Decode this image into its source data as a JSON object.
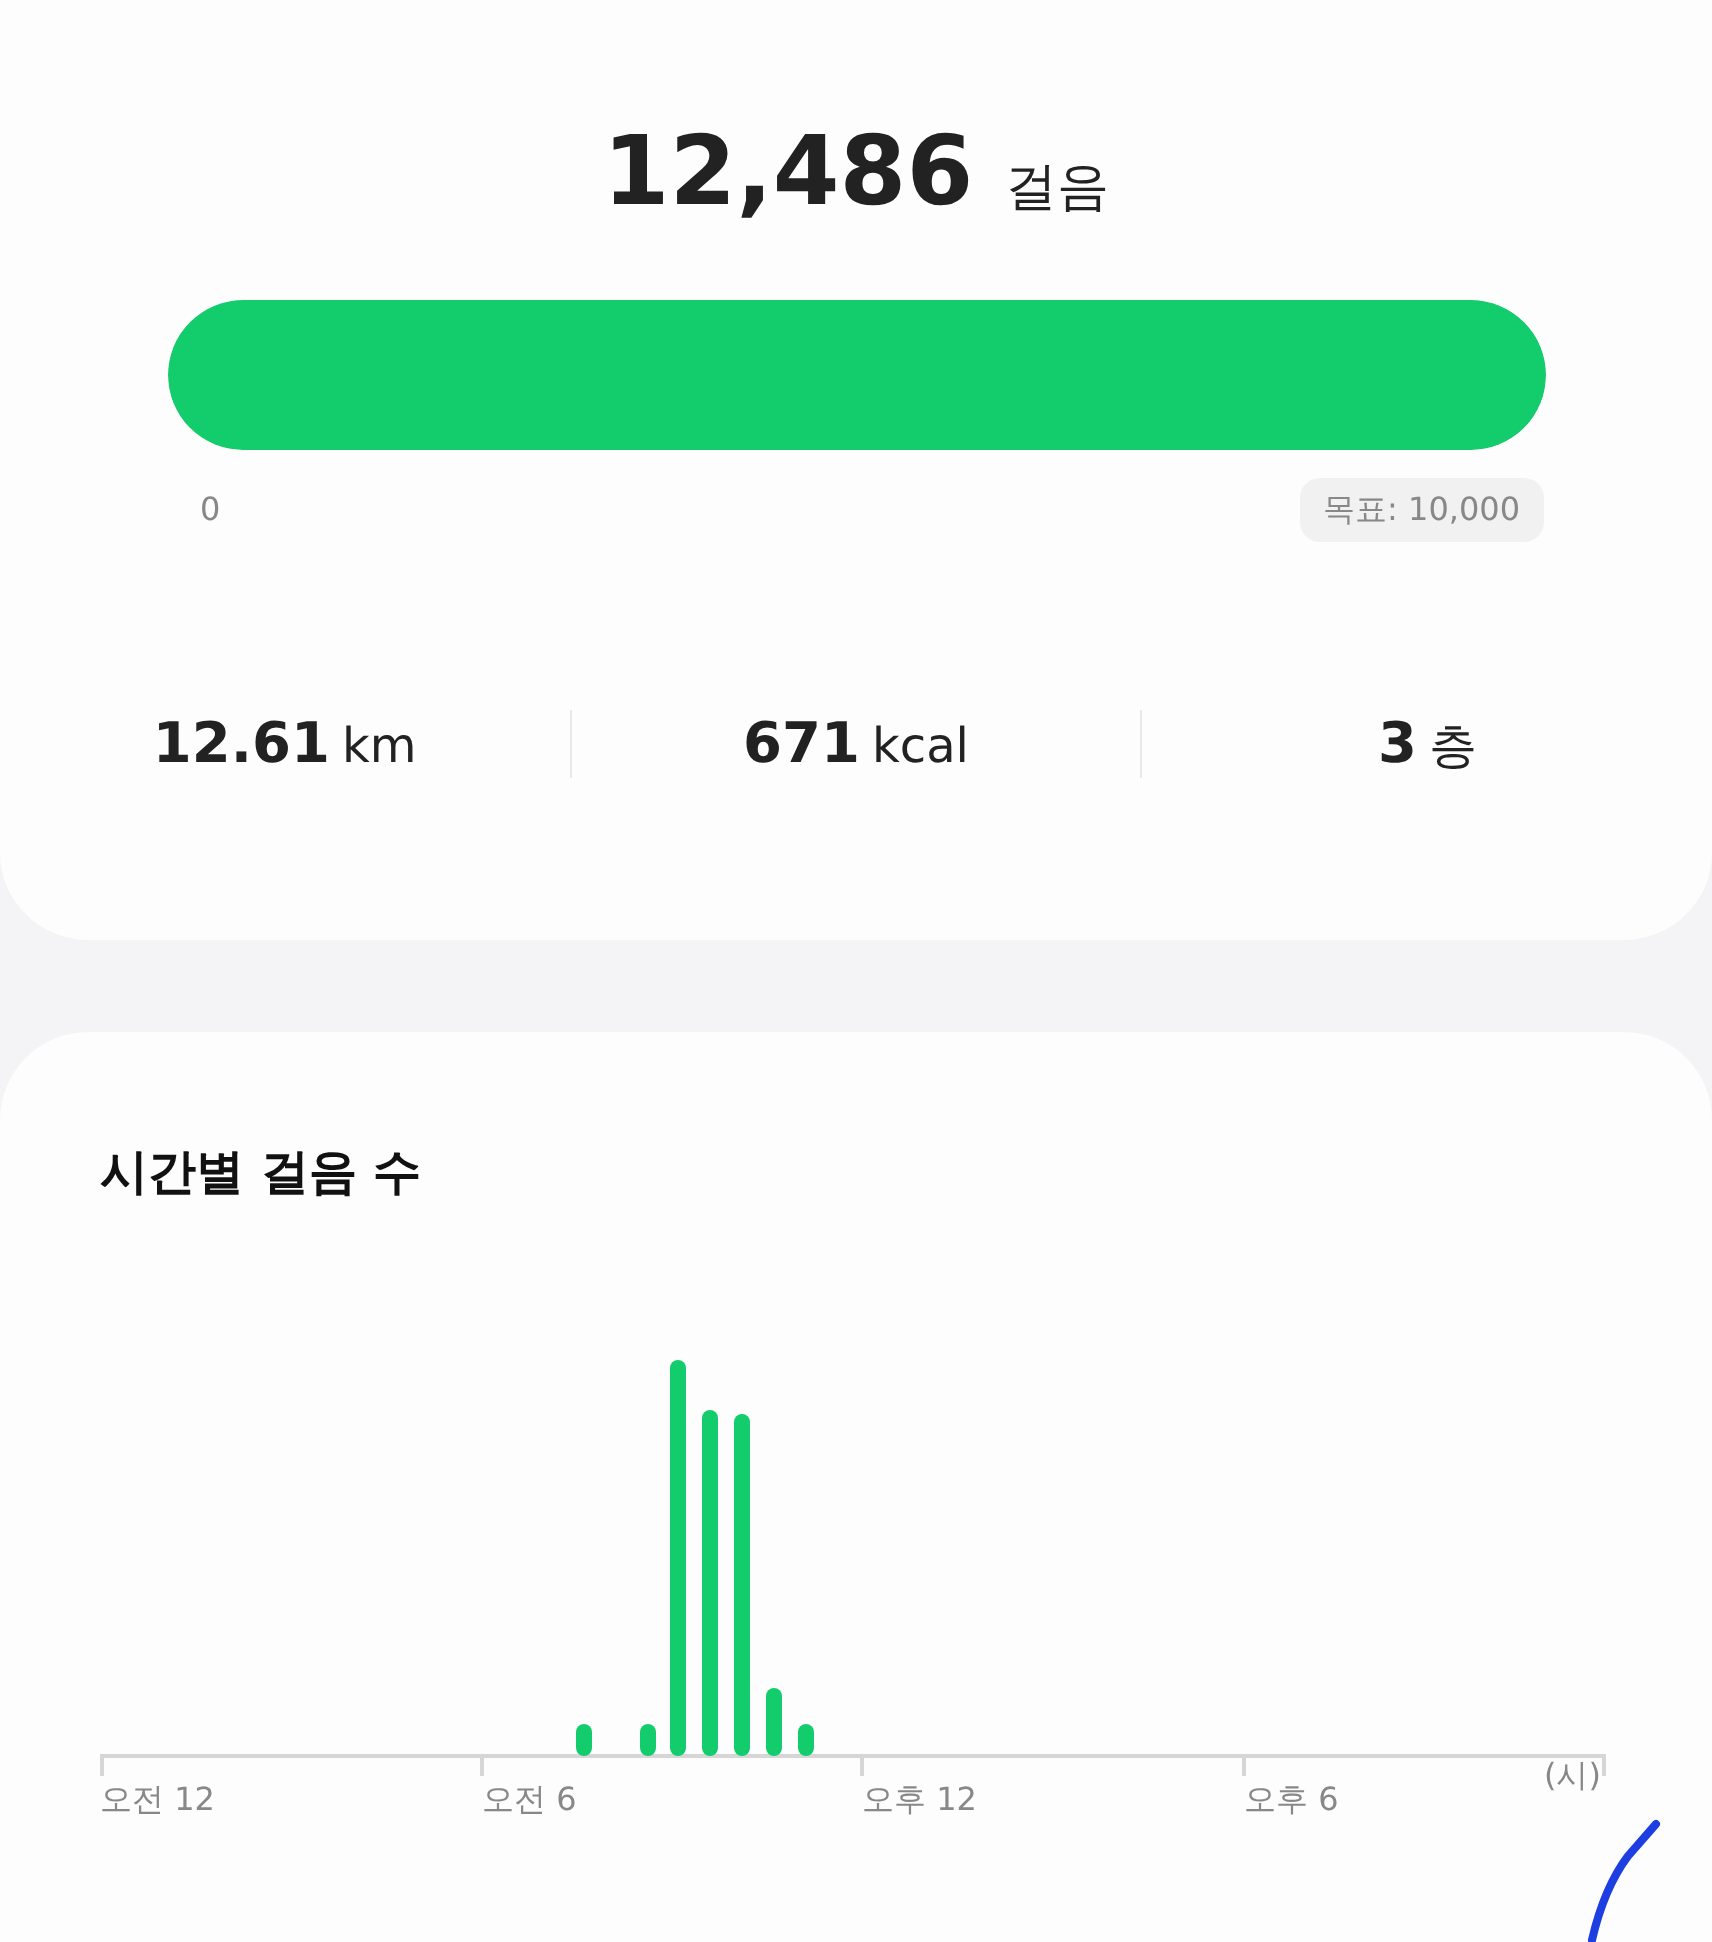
{
  "summary": {
    "steps": "12,486",
    "unit": "걸음",
    "progress": {
      "level": 1.0,
      "start_label": "0",
      "goal_label": "목표: 10,000"
    },
    "stats": [
      {
        "value": "12.61",
        "unit": "km"
      },
      {
        "value": "671",
        "unit": "kcal"
      },
      {
        "value": "3",
        "unit": "층"
      }
    ]
  },
  "hourly": {
    "title": "시간별 걸음 수",
    "x_labels": [
      "오전 12",
      "오전 6",
      "오후 12",
      "오후 6"
    ],
    "x_unit": "(시)"
  }
}
